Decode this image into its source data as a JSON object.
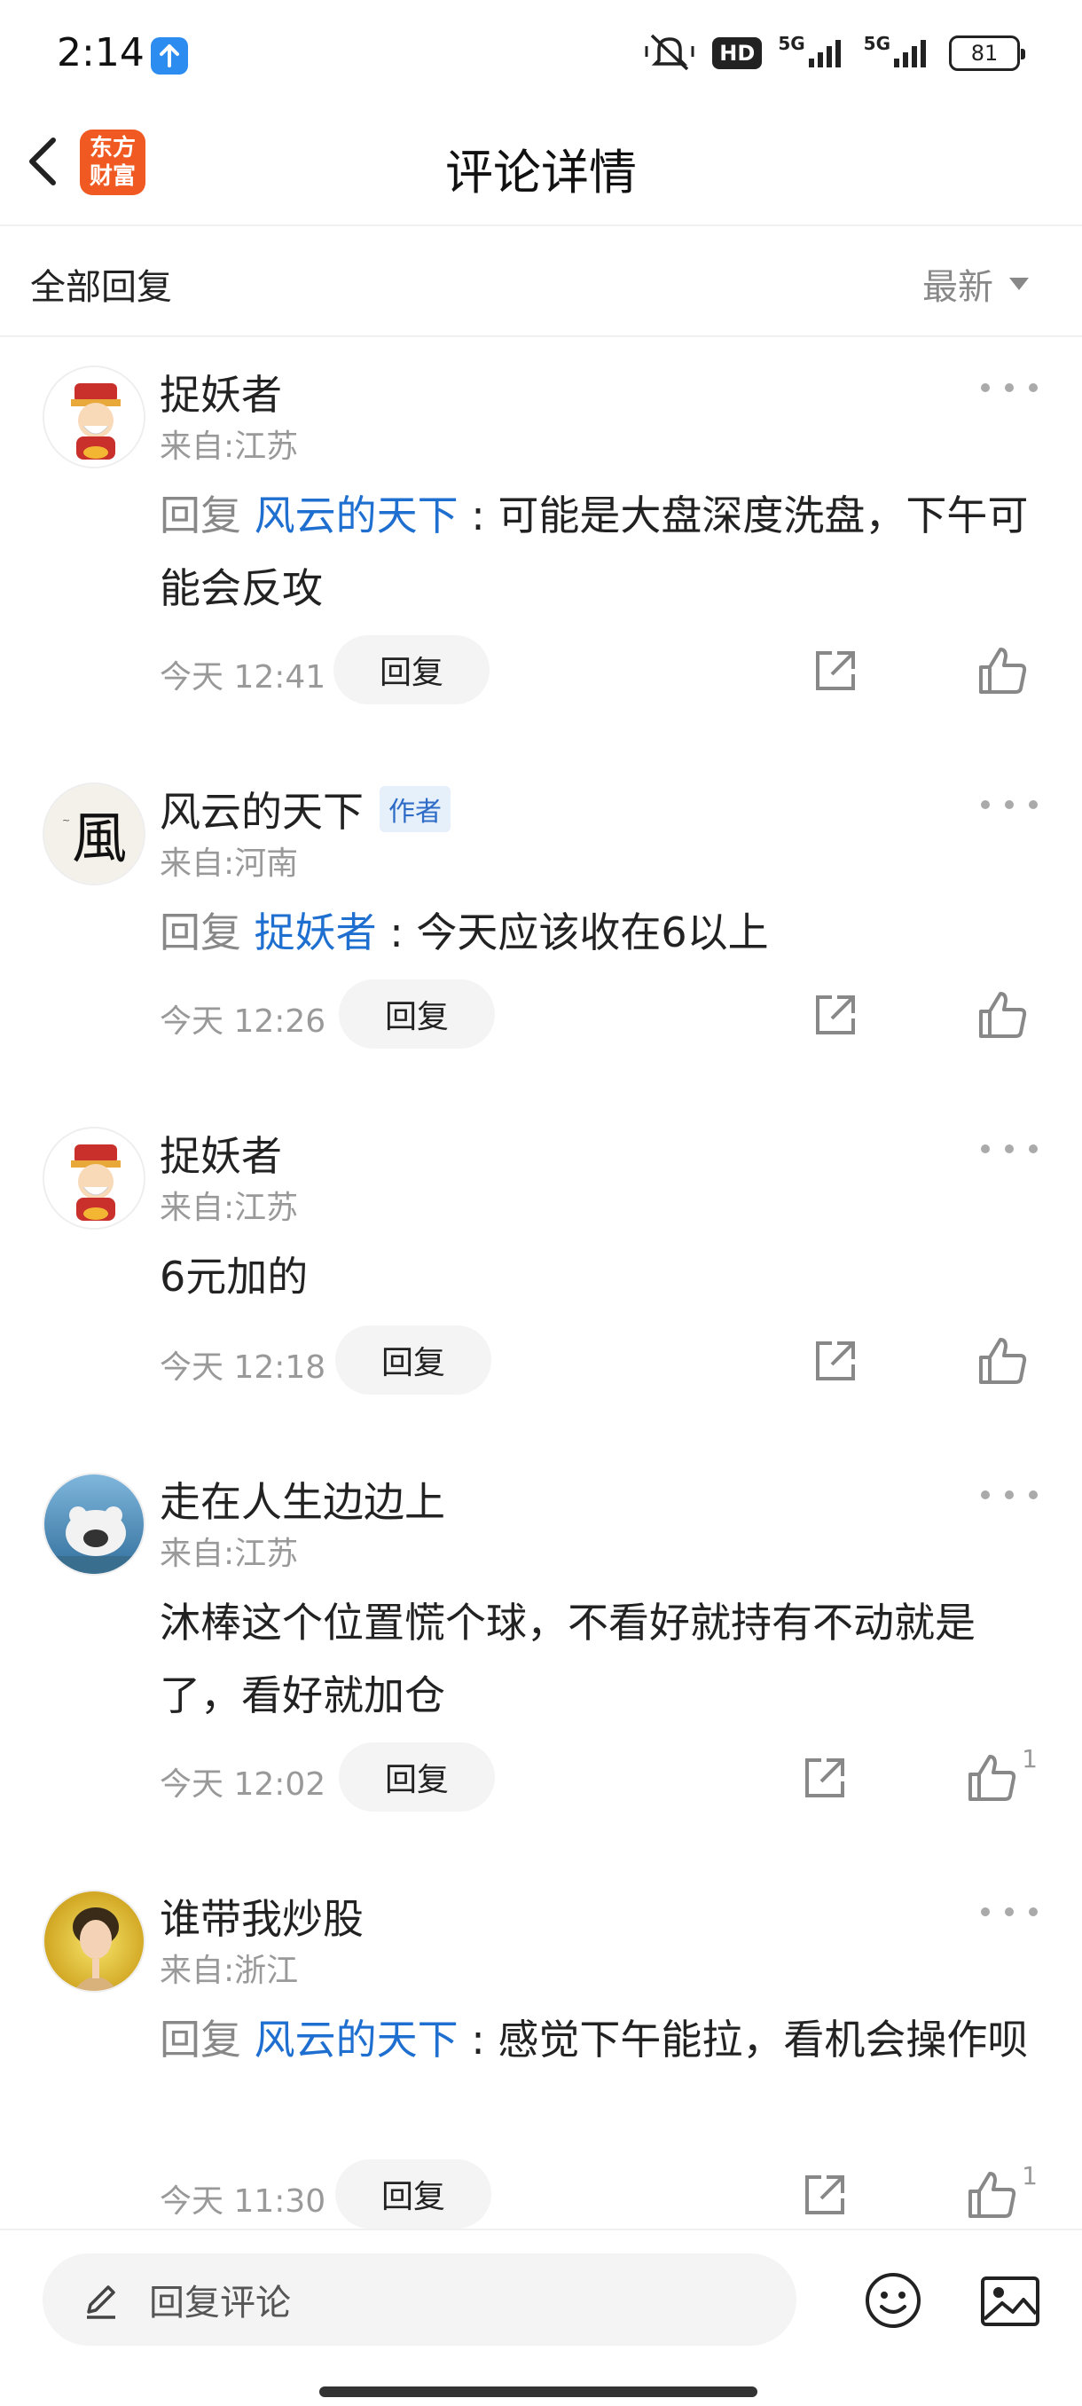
{
  "status_bar": {
    "time": "2:14",
    "hd_label": "HD",
    "network_1": "5G",
    "network_2": "5G",
    "battery": "81"
  },
  "nav": {
    "title": "评论详情",
    "app_logo_line1": "东方",
    "app_logo_line2": "财富"
  },
  "section": {
    "title": "全部回复",
    "sort_label": "最新"
  },
  "comments": [
    {
      "username": "捉妖者",
      "location": "来自:江苏",
      "reply_prefix": "回复",
      "mention": "风云的天下",
      "text": " : 可能是大盘深度洗盘，下午可能会反攻",
      "time": "今天 12:41",
      "reply_label": "回复",
      "likes": ""
    },
    {
      "username": "风云的天下",
      "author_tag": "作者",
      "location": "来自:河南",
      "reply_prefix": "回复",
      "mention": "捉妖者",
      "text": " : 今天应该收在6以上",
      "time": "今天 12:26",
      "reply_label": "回复",
      "likes": ""
    },
    {
      "username": "捉妖者",
      "location": "来自:江苏",
      "text": "6元加的",
      "time": "今天 12:18",
      "reply_label": "回复",
      "likes": ""
    },
    {
      "username": "走在人生边边上",
      "location": "来自:江苏",
      "text": "沐棒这个位置慌个球，不看好就持有不动就是了，看好就加仓",
      "time": "今天 12:02",
      "reply_label": "回复",
      "likes": "1"
    },
    {
      "username": "谁带我炒股",
      "location": "来自:浙江",
      "reply_prefix": "回复",
      "mention": "风云的天下",
      "text": " : 感觉下午能拉，看机会操作呗",
      "time": "今天 11:30",
      "reply_label": "回复",
      "likes": "1"
    }
  ],
  "bottom_bar": {
    "input_placeholder": "回复评论"
  },
  "icons": {
    "back": "chevron-left-icon",
    "more": "more-dots-icon",
    "share": "share-icon",
    "like": "thumbs-up-icon",
    "edit": "pencil-icon",
    "emoji": "emoji-icon",
    "image": "image-icon"
  },
  "colors": {
    "mention": "#1e6fd0",
    "logo": "#f05a22",
    "author_tag_bg": "#e6f0fb"
  }
}
